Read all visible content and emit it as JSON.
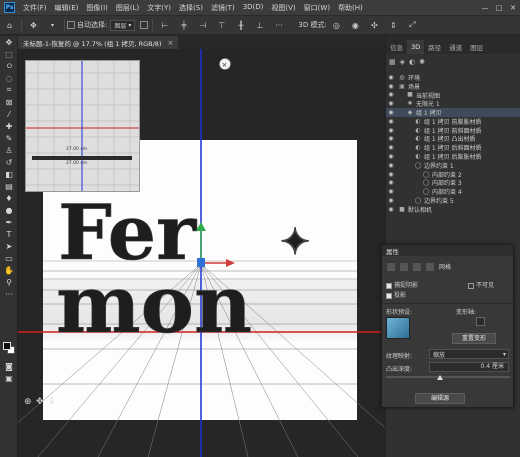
{
  "app": {
    "logo": "Ps"
  },
  "menubar": {
    "items": [
      "文件(F)",
      "编辑(E)",
      "图像(I)",
      "图层(L)",
      "文字(Y)",
      "选择(S)",
      "滤镜(T)",
      "3D(D)",
      "视图(V)",
      "窗口(W)",
      "帮助(H)"
    ],
    "window_controls": [
      "—",
      "□",
      "✕"
    ]
  },
  "options_bar": {
    "auto_select_label": "自动选择:",
    "auto_select_value": "图层",
    "mode_label": "3D 模式:"
  },
  "document": {
    "tab_title": "未标题-1-恢复的 @ 17.7% (组 1 拷贝, RGB/8)",
    "tab_close": "×",
    "artwork_text_top": "Fer",
    "artwork_text_bottom": "mon",
    "artwork_ornament": "✦",
    "navigator_label_top": "27.00  cm",
    "navigator_label_bottom": "27.00  cm"
  },
  "right_panel": {
    "tabs": [
      "信息",
      "3D",
      "路径",
      "通道",
      "图层"
    ],
    "active_tab": "3D",
    "layers": [
      {
        "name": "环境",
        "indent": 0,
        "icon": "globe-icon",
        "selected": false
      },
      {
        "name": "场景",
        "indent": 0,
        "icon": "scene-icon",
        "selected": false
      },
      {
        "name": "当前视图",
        "indent": 1,
        "icon": "camera-icon",
        "selected": false
      },
      {
        "name": "无限光 1",
        "indent": 1,
        "icon": "light-icon",
        "selected": false
      },
      {
        "name": "组 1 拷贝",
        "indent": 1,
        "icon": "group-icon",
        "selected": true
      },
      {
        "name": "组 1 拷贝 前膨胀材质",
        "indent": 2,
        "icon": "material-icon",
        "selected": false
      },
      {
        "name": "组 1 拷贝 前斜面材质",
        "indent": 2,
        "icon": "material-icon",
        "selected": false
      },
      {
        "name": "组 1 拷贝 凸出材质",
        "indent": 2,
        "icon": "material-icon",
        "selected": false
      },
      {
        "name": "组 1 拷贝 后斜面材质",
        "indent": 2,
        "icon": "material-icon",
        "selected": false
      },
      {
        "name": "组 1 拷贝 后膨胀材质",
        "indent": 2,
        "icon": "material-icon",
        "selected": false
      },
      {
        "name": "边界约束 1",
        "indent": 2,
        "icon": "constraint-icon",
        "selected": false
      },
      {
        "name": "内部约束 2",
        "indent": 3,
        "icon": "constraint-icon",
        "selected": false
      },
      {
        "name": "内部约束 3",
        "indent": 3,
        "icon": "constraint-icon",
        "selected": false
      },
      {
        "name": "内部约束 4",
        "indent": 3,
        "icon": "constraint-icon",
        "selected": false
      },
      {
        "name": "边界约束 5",
        "indent": 2,
        "icon": "constraint-icon",
        "selected": false
      },
      {
        "name": "默认相机",
        "indent": 0,
        "icon": "camera-icon",
        "selected": false
      }
    ]
  },
  "properties": {
    "title": "属性",
    "mesh_label": "网格",
    "catch_shadows": "捕捉阴影",
    "invisible": "不可见",
    "cast_shadows": "投影",
    "shape_preset_label": "形状预设:",
    "deform_axis_label": "变形轴:",
    "reset_deform": "重置变形",
    "texture_map_label": "纹理映射:",
    "texture_map_value": "缩放",
    "extrusion_depth_label": "凸出深度:",
    "extrusion_depth_value": "0.4 厘米",
    "edit_source_button": "编辑源"
  },
  "colors": {
    "accent_blue": "#1e6fd9",
    "menubar": "#3c3c3c",
    "panel": "#313131",
    "selection": "#3f4b5a"
  }
}
